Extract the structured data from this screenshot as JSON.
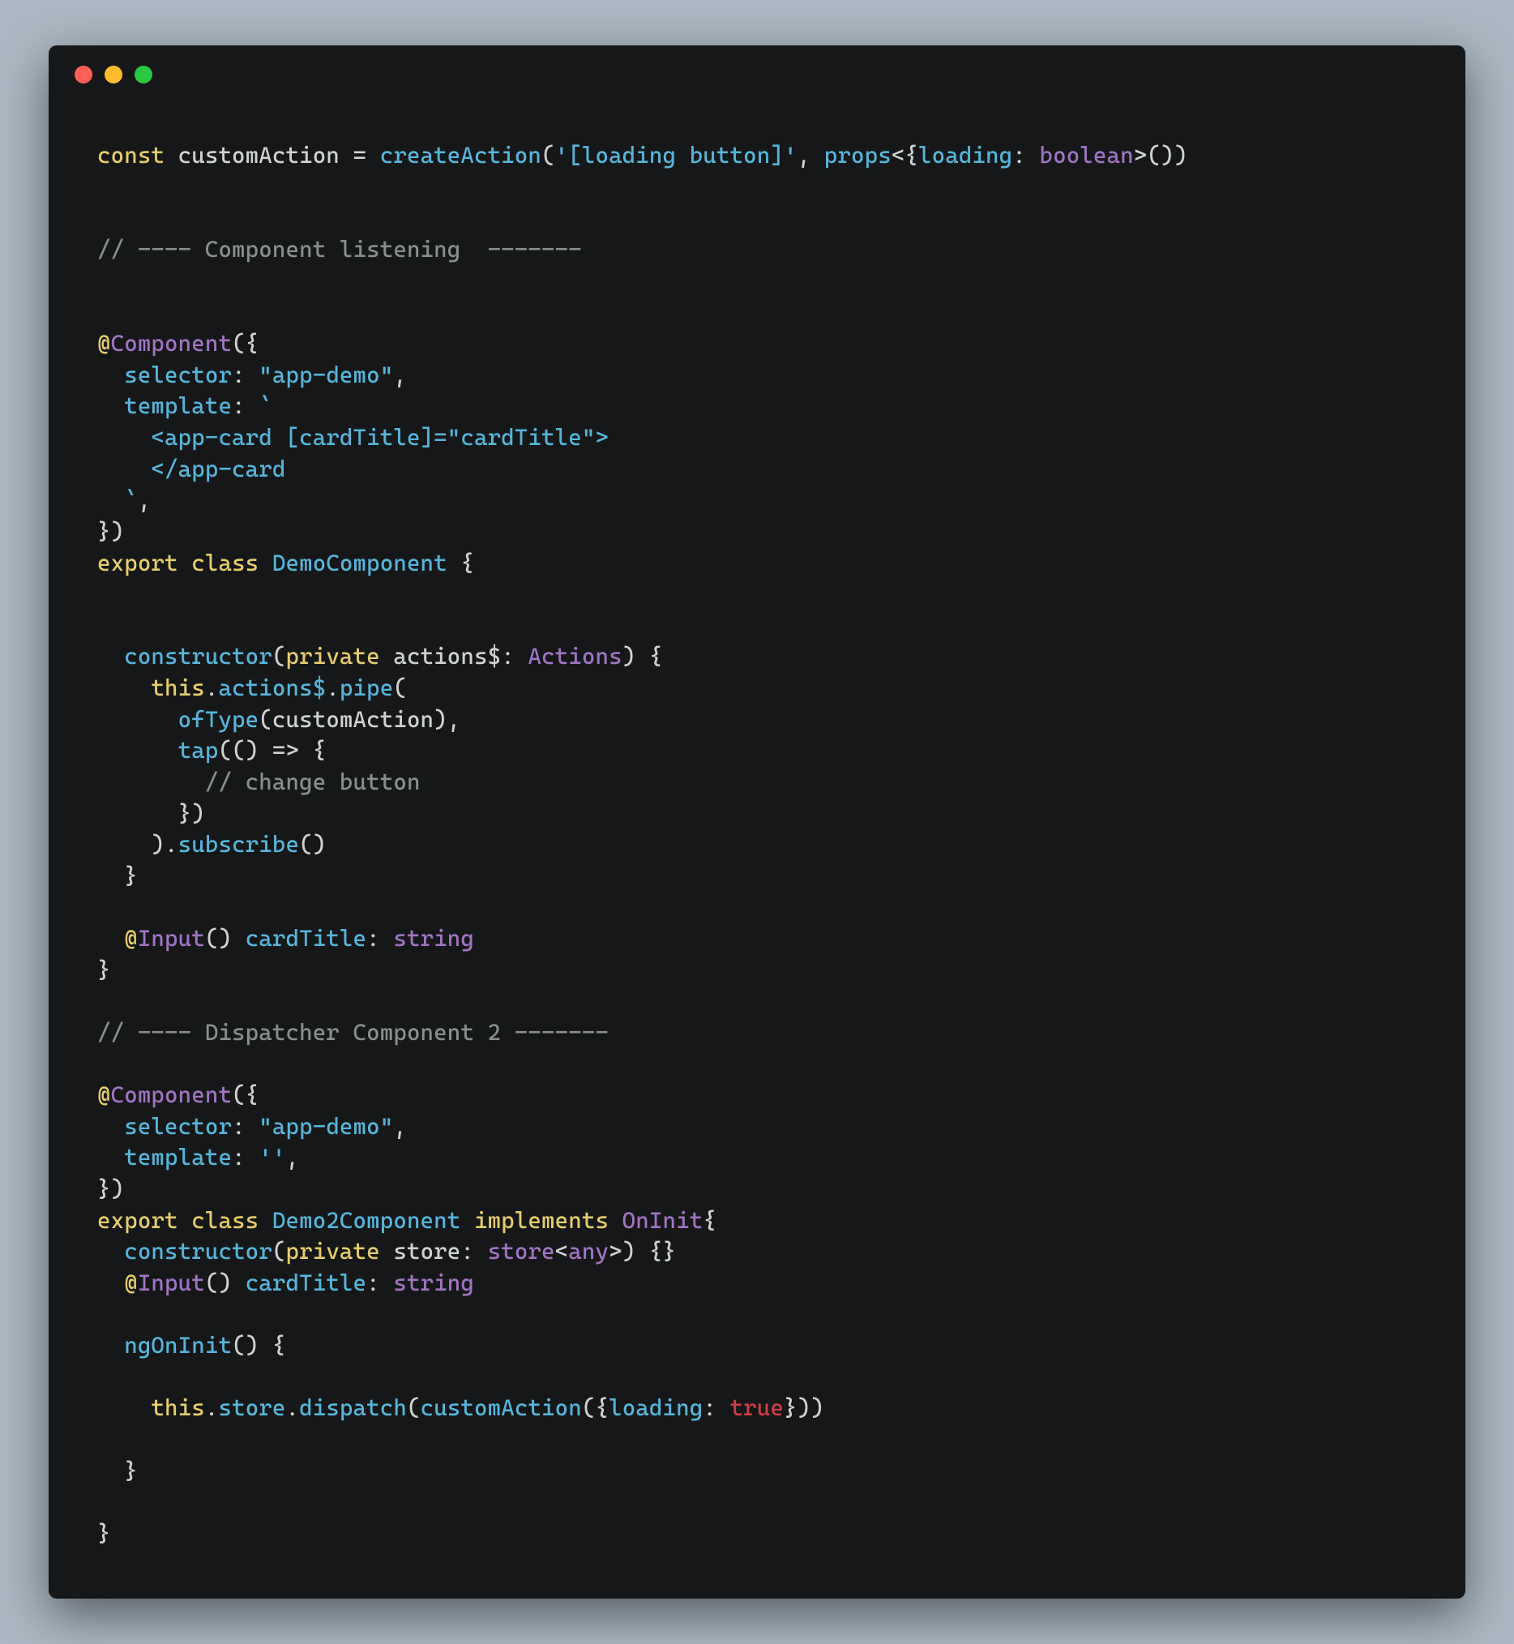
{
  "colors": {
    "background": "#abb8c3",
    "window": "#151718",
    "red": "#ff5f56",
    "yellow": "#ffbd2e",
    "green": "#27c93f"
  },
  "code": {
    "l1_const": "const",
    "l1_name": " customAction ",
    "l1_eq": "= ",
    "l1_fn": "createAction",
    "l1_p1": "(",
    "l1_str": "'[loading button]'",
    "l1_c": ", ",
    "l1_props": "props",
    "l1_lt": "<{",
    "l1_k": "loading",
    "l1_col": ": ",
    "l1_t": "boolean",
    "l1_gt": ">())",
    "c1": "// ---- Component listening  -------",
    "dec_at": "@",
    "dec_name": "Component",
    "dec_open": "({",
    "sel_k": "selector",
    "sel_v": "\"app-demo\"",
    "tmpl_k": "template",
    "tmpl_tick": "`",
    "tmpl_l1": "    <app-card [cardTitle]=\"cardTitle\">",
    "tmpl_l2": "    </app-card",
    "tmpl_end": "  `",
    "dec_close": "})",
    "exp": "export",
    "cls": "class",
    "cname1": "DemoComponent",
    "brace_o": " {",
    "ctor": "constructor",
    "priv": "private",
    "actions_name": " actions$",
    "actions_t": "Actions",
    "paren_brace": ") {",
    "this": "this",
    "dot": ".",
    "actions_prop": "actions$",
    "pipe": "pipe",
    "paren_o": "(",
    "ofType": "ofType",
    "ofType_arg": "customAction",
    "paren_c_comma": "),",
    "tap": "tap",
    "arrow": "(() => {",
    "c_change": "// change button",
    "tap_close": "})",
    "pipe_close": ").",
    "subscribe": "subscribe",
    "sub_p": "()",
    "brace_c": "}",
    "input_at": "@",
    "input_name": "Input",
    "input_p": "() ",
    "cardTitle": "cardTitle",
    "string_t": "string",
    "c2": "// ---- Dispatcher Component 2 -------",
    "sel_v2": "\"app-demo\"",
    "tmpl_v2": "''",
    "cname2": "Demo2Component",
    "impl": "implements",
    "oninit": "OnInit",
    "store_name": " store",
    "store_t": "store",
    "any_t": "any",
    "empty_braces": " {}",
    "ngoninit": "ngOnInit",
    "ngoninit_p": "() {",
    "store_prop": "store",
    "dispatch": "dispatch",
    "customAction_call": "customAction",
    "loading_k": "loading",
    "true_v": "true",
    "dispatch_close": "}))"
  }
}
